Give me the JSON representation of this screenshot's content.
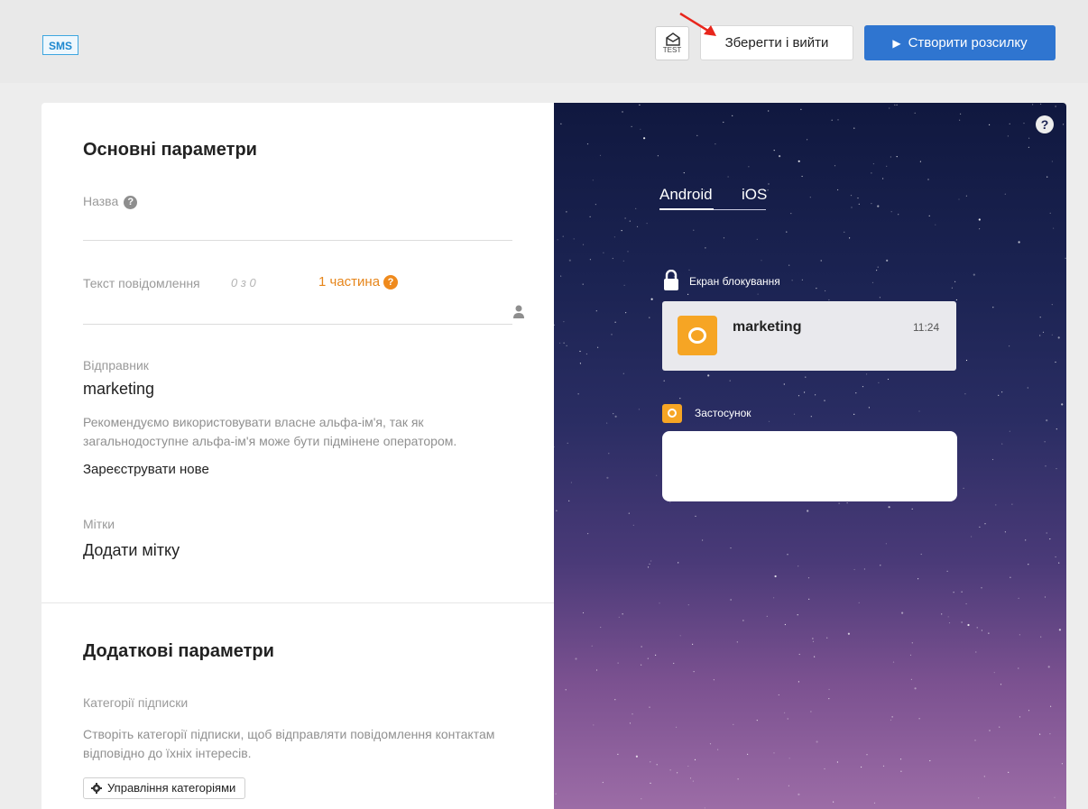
{
  "header": {
    "channel_badge": "SMS",
    "test_label": "TEST",
    "save_exit_label": "Зберегти і вийти",
    "create_campaign_label": "Створити розсилку"
  },
  "main_params": {
    "title": "Основні параметри",
    "name_label": "Назва",
    "message_text_label": "Текст повідомлення",
    "char_counter": "0 з 0",
    "parts_label": "1 частина",
    "sender_label": "Відправник",
    "sender_value": "marketing",
    "sender_hint": "Рекомендуємо використовувати власне альфа-ім'я, так як загальнодоступне альфа-ім'я може бути підмінене оператором.",
    "register_new_label": "Зареєструвати нове",
    "tags_label": "Мітки",
    "add_tag_label": "Додати мітку"
  },
  "extra_params": {
    "title": "Додаткові параметри",
    "subscription_categories_label": "Категорії підписки",
    "categories_hint": "Створіть категорії підписки, щоб відправляти повідомлення контактам відповідно до їхніх інтересів.",
    "manage_categories_label": "Управління категоріями"
  },
  "preview": {
    "tabs": [
      "Android",
      "iOS"
    ],
    "active_tab": "Android",
    "lock_screen_label": "Екран блокування",
    "notification": {
      "sender": "marketing",
      "time": "11:24"
    },
    "app_label": "Застосунок"
  },
  "colors": {
    "accent_blue": "#2f75d0",
    "orange": "#ef8a1d",
    "app_icon": "#f6a524"
  }
}
